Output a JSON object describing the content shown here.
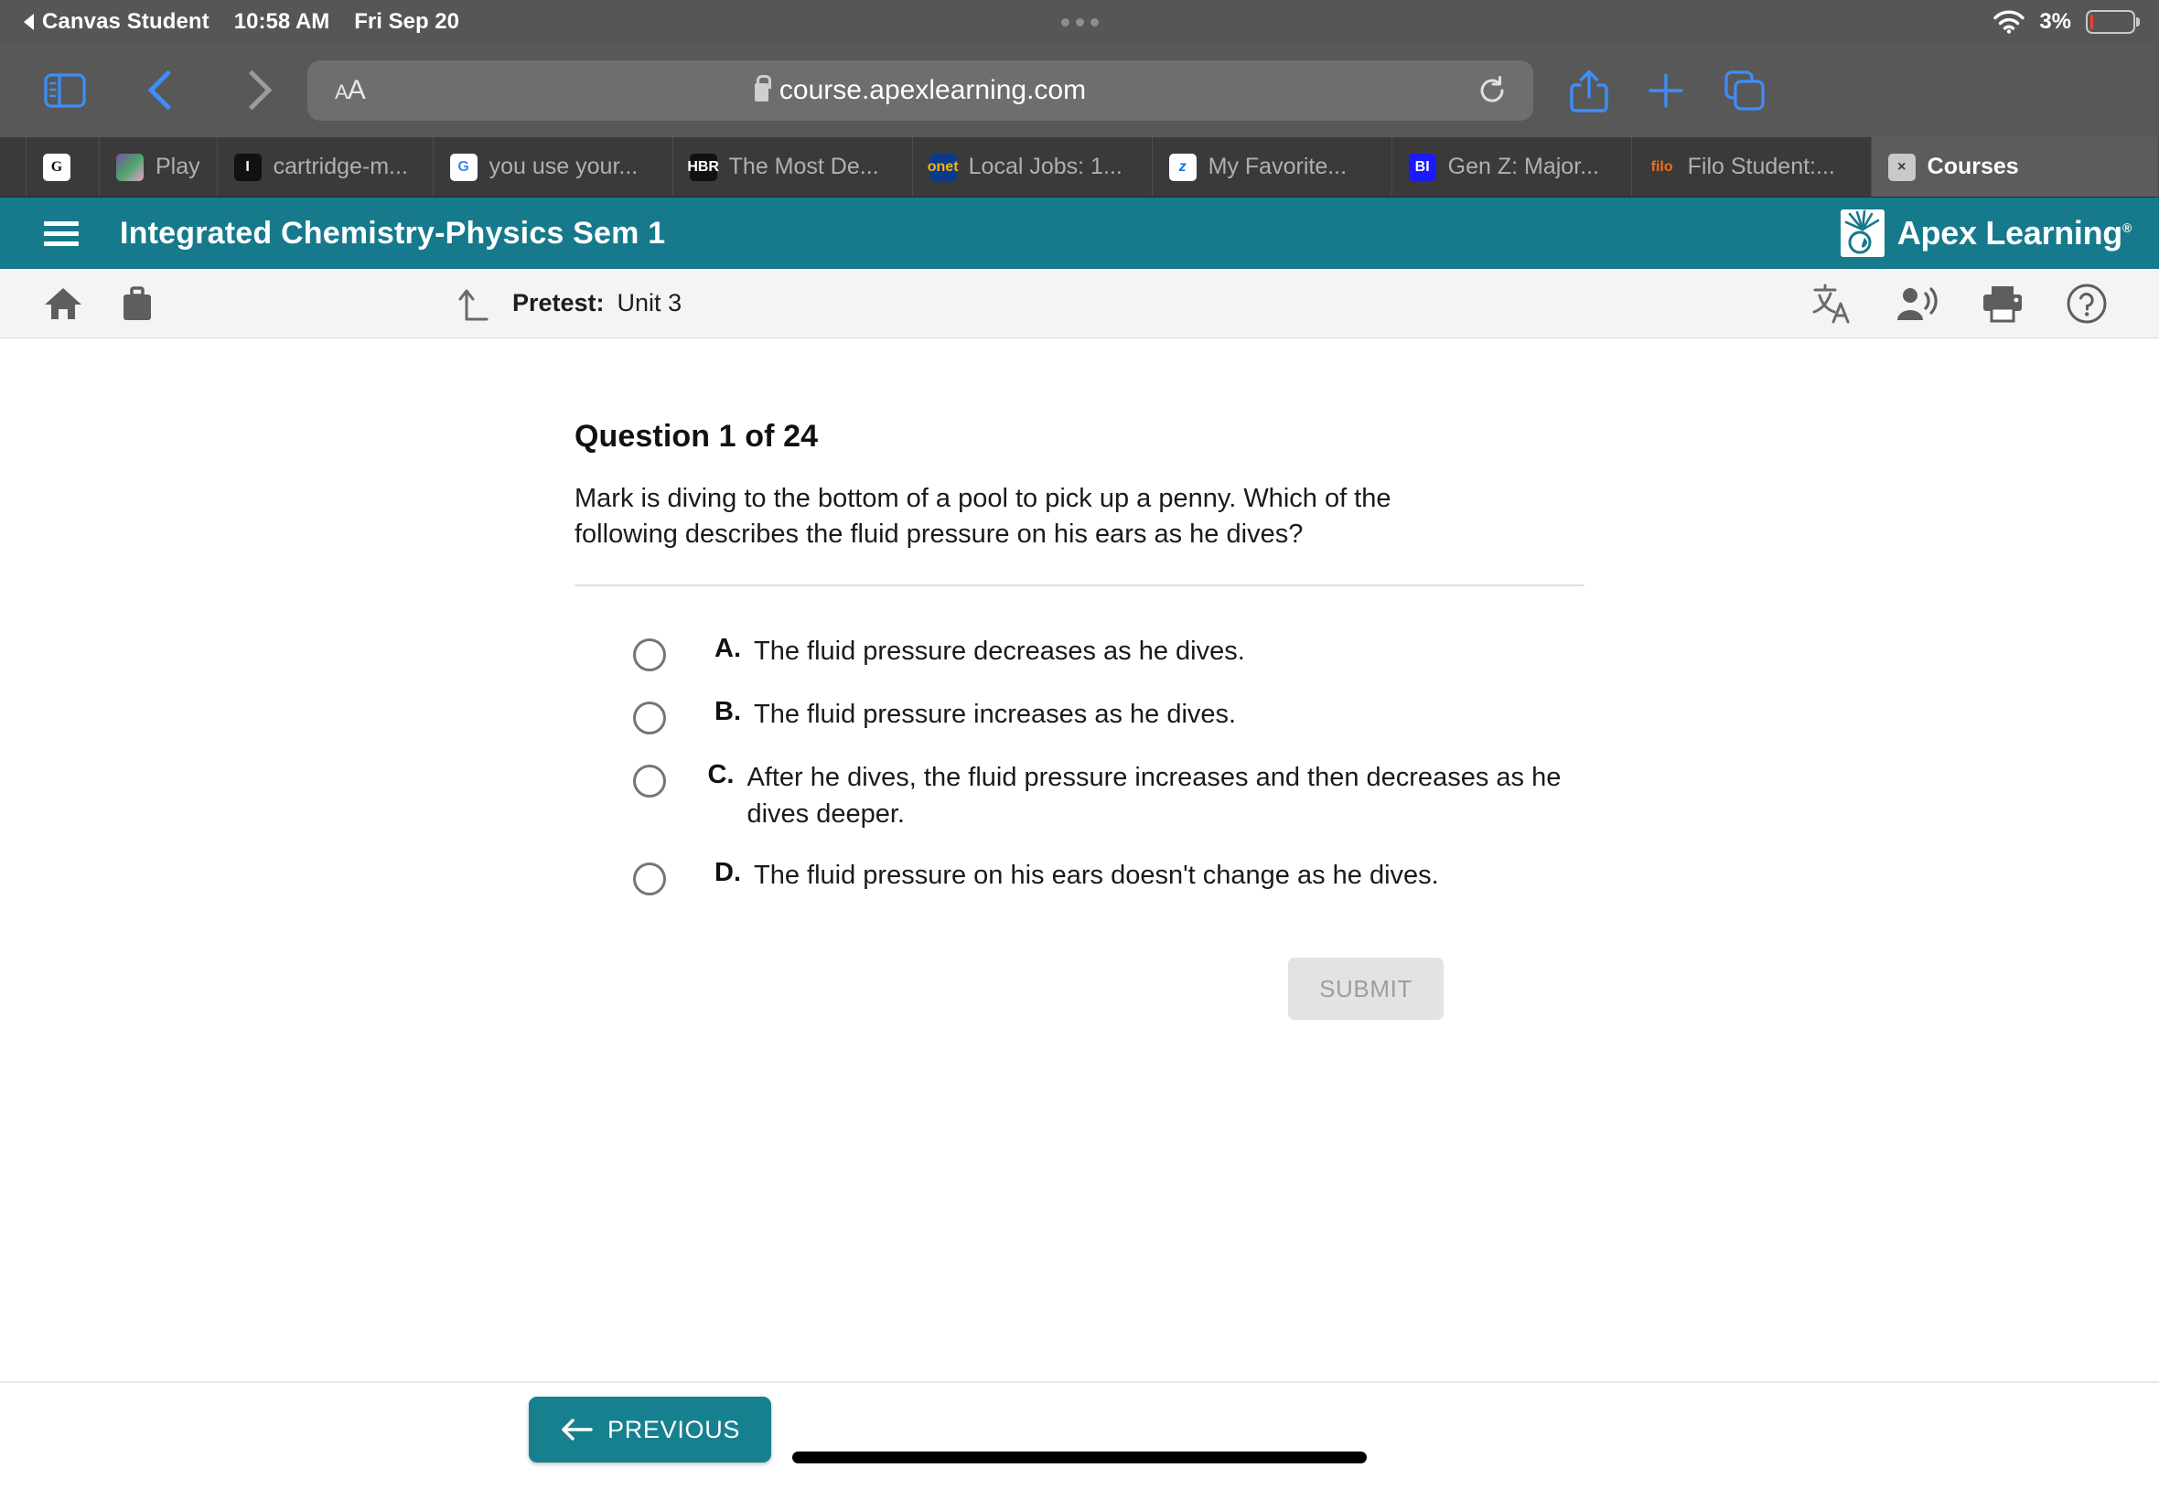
{
  "status_bar": {
    "back_app": "Canvas Student",
    "back_icon": "triangle-left-icon",
    "time": "10:58 AM",
    "date": "Fri Sep 20",
    "wifi_icon": "wifi-icon",
    "battery_percent": "3%",
    "battery_level": 3,
    "battery_color": "#ff3b30"
  },
  "browser": {
    "sidebar_icon": "sidebar-icon",
    "back_icon": "chevron-left-icon",
    "forward_icon": "chevron-right-icon",
    "aa_label": "AA",
    "lock_icon": "lock-icon",
    "url": "course.apexlearning.com",
    "reload_icon": "reload-icon",
    "share_icon": "share-icon",
    "new_tab_icon": "plus-icon",
    "tabs_overview_icon": "tabs-icon",
    "accent_color": "#3d8ef7"
  },
  "tabs": [
    {
      "favicon": "g-icon",
      "label": "",
      "active": false
    },
    {
      "favicon": "play-icon",
      "label": "Play ",
      "active": false
    },
    {
      "favicon": "i-icon",
      "label": "cartridge-m...",
      "active": false
    },
    {
      "favicon": "google-icon",
      "label": "you use your...",
      "active": false
    },
    {
      "favicon": "hbr-icon",
      "label": "The Most De...",
      "active": false
    },
    {
      "favicon": "onet-icon",
      "label": "Local Jobs: 1...",
      "active": false
    },
    {
      "favicon": "zillow-icon",
      "label": "My Favorite...",
      "active": false
    },
    {
      "favicon": "bi-icon",
      "label": "Gen Z: Major...",
      "active": false
    },
    {
      "favicon": "filo-icon",
      "label": "Filo Student:...",
      "active": false
    },
    {
      "favicon": "close-icon",
      "label": "Courses",
      "active": true
    }
  ],
  "course_header": {
    "menu_icon": "hamburger-menu-icon",
    "title": "Integrated Chemistry-Physics Sem 1",
    "brand_icon": "apex-sunburst-icon",
    "brand_name": "Apex Learning",
    "brand_trademark": "®",
    "background_color": "#16798c"
  },
  "subnav": {
    "home_icon": "home-icon",
    "briefcase_icon": "briefcase-icon",
    "level_up_icon": "level-up-arrow-icon",
    "crumb_label": "Pretest:",
    "crumb_value": "Unit 3",
    "translate_icon": "translate-icon",
    "read_aloud_icon": "read-aloud-icon",
    "print_icon": "print-icon",
    "help_icon": "help-circle-icon"
  },
  "question": {
    "heading": "Question 1 of 24",
    "number": 1,
    "total": 24,
    "prompt": "Mark is diving to the bottom of a pool to pick up a penny. Which of the following describes the fluid pressure on his ears as he dives?",
    "options": [
      {
        "letter": "A.",
        "text": "The fluid pressure decreases as he dives.",
        "selected": false
      },
      {
        "letter": "B.",
        "text": "The fluid pressure increases as he dives.",
        "selected": false
      },
      {
        "letter": "C.",
        "text": "After he dives, the fluid pressure increases and then decreases as he dives deeper.",
        "selected": false
      },
      {
        "letter": "D.",
        "text": "The fluid pressure on his ears doesn't change as he dives.",
        "selected": false
      }
    ],
    "submit_label": "SUBMIT",
    "submit_enabled": false
  },
  "footer": {
    "previous_icon": "arrow-left-icon",
    "previous_label": "PREVIOUS",
    "previous_color": "#17808f",
    "home_indicator": "home-indicator"
  }
}
